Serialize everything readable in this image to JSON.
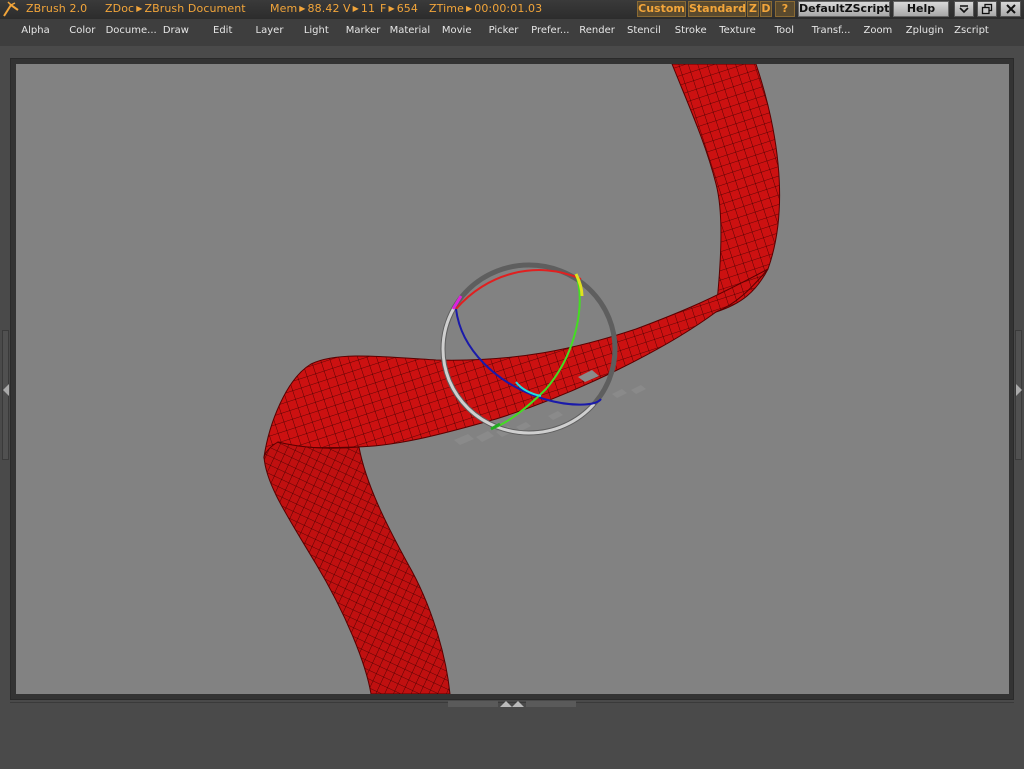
{
  "titlebar": {
    "app": "ZBrush 2.0",
    "doc_prefix": "ZDoc",
    "doc_name": "ZBrush Document",
    "mem_label": "Mem",
    "mem_value": "88.42",
    "v_label": "V",
    "v_value": "11",
    "f_label": "F",
    "f_value": "654",
    "ztime_label": "ZTime",
    "ztime_value": "00:00:01.03",
    "buttons": {
      "custom": "Custom",
      "standard": "Standard",
      "z": "Z",
      "d": "D",
      "question": "?",
      "script": "DefaultZScript",
      "help": "Help"
    }
  },
  "menu": [
    "Alpha",
    "Color",
    "Docume...",
    "Draw",
    "Edit",
    "Layer",
    "Light",
    "Marker",
    "Material",
    "Movie",
    "Picker",
    "Prefer...",
    "Render",
    "Stencil",
    "Stroke",
    "Texture",
    "Tool",
    "Transf...",
    "Zoom",
    "Zplugin",
    "Zscript"
  ],
  "colors": {
    "accent": "#f2a53a",
    "canvas": "#828282",
    "ribbon": "#cc1111",
    "mesh": "#3a0000"
  },
  "icons": {
    "logo": "zbrush-logo-icon",
    "minimize": "minimize-icon",
    "restore": "restore-icon",
    "close": "close-icon",
    "left_tray": "left-arrow-icon",
    "right_tray": "right-arrow-icon",
    "bottom_tray": "up-arrow-icon"
  }
}
